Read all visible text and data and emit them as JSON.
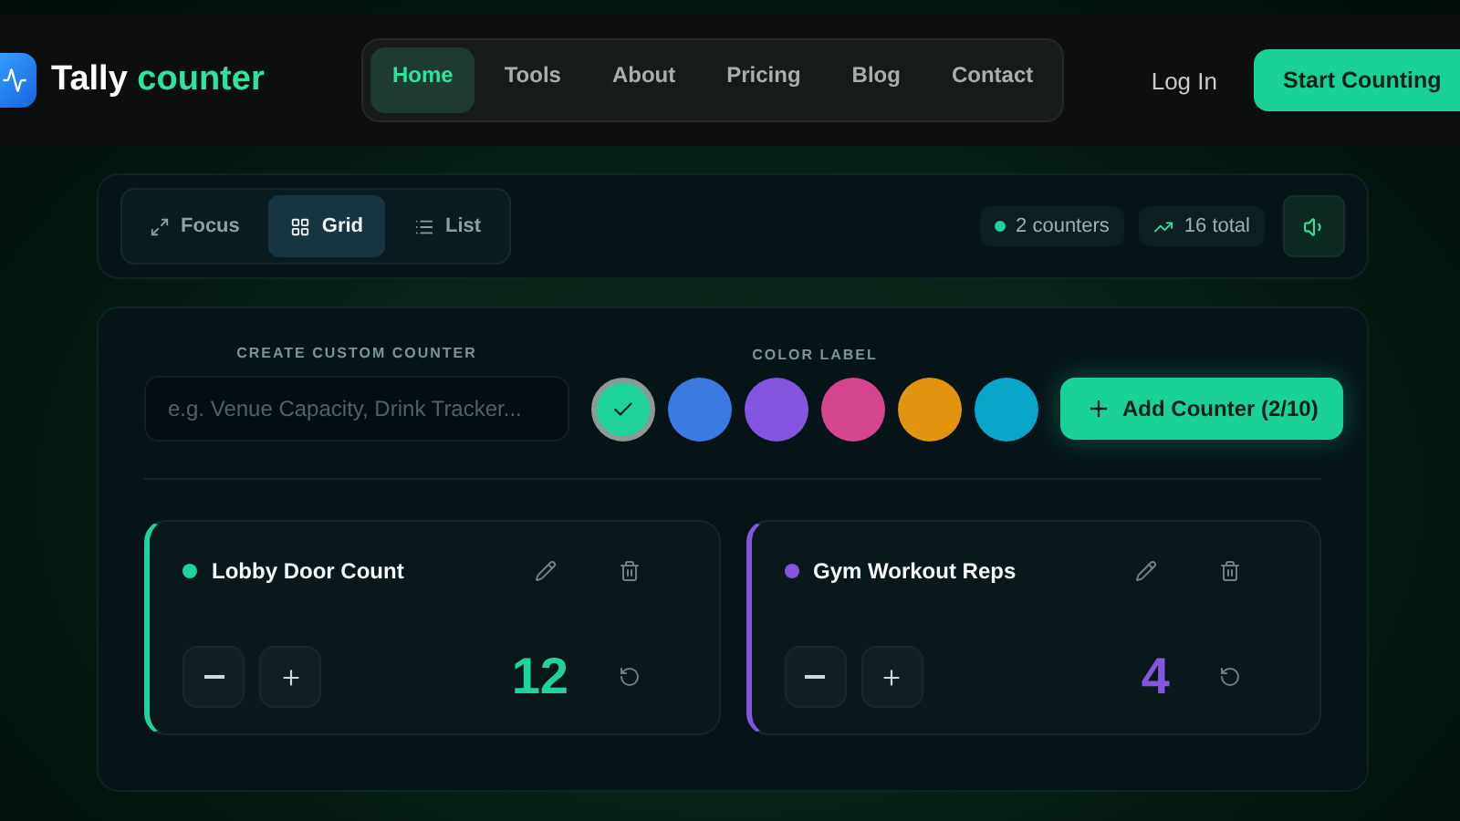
{
  "header": {
    "logo": {
      "word1": "Tally",
      "word2": "counter"
    },
    "nav": [
      {
        "label": "Home",
        "selected": true
      },
      {
        "label": "Tools",
        "selected": false
      },
      {
        "label": "About",
        "selected": false
      },
      {
        "label": "Pricing",
        "selected": false
      },
      {
        "label": "Blog",
        "selected": false
      },
      {
        "label": "Contact",
        "selected": false
      }
    ],
    "login": "Log In",
    "cta": "Start Counting"
  },
  "toolbar": {
    "views": [
      {
        "label": "Focus",
        "kind": "focus",
        "selected": false
      },
      {
        "label": "Grid",
        "kind": "grid",
        "selected": true
      },
      {
        "label": "List",
        "kind": "list",
        "selected": false
      }
    ],
    "counters_badge": "2 counters",
    "total_badge": "16 total",
    "sound_on": true
  },
  "create": {
    "name_label": "CREATE CUSTOM COUNTER",
    "placeholder": "e.g. Venue Capacity, Drink Tracker...",
    "color_label": "COLOR LABEL",
    "colors": [
      {
        "color": "#1fd49a",
        "selected": true
      },
      {
        "color": "#3b7be0",
        "selected": false
      },
      {
        "color": "#8456e0",
        "selected": false
      },
      {
        "color": "#d6468e",
        "selected": false
      },
      {
        "color": "#e2930f",
        "selected": false
      },
      {
        "color": "#0aa6c9",
        "selected": false
      }
    ],
    "add_button": "Add Counter (2/10)"
  },
  "counters": [
    {
      "name": "Lobby Door Count",
      "color": "#1fd49a",
      "value": "12"
    },
    {
      "name": "Gym Workout Reps",
      "color": "#8456e0",
      "value": "4"
    }
  ]
}
